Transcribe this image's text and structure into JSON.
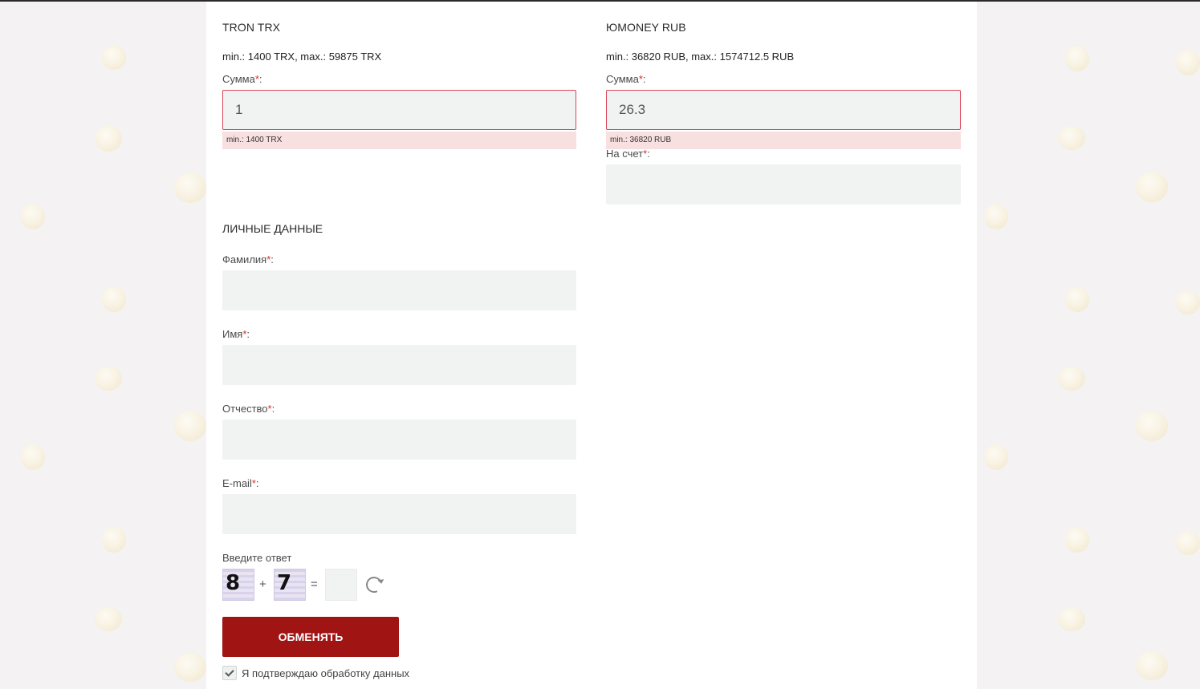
{
  "give": {
    "title": "TRON TRX",
    "limits": "min.: 1400 TRX, max.: 59875 TRX",
    "amount_label": "Сумма",
    "amount_value": "1",
    "error": "min.: 1400 TRX"
  },
  "receive": {
    "title": "ЮMONEY RUB",
    "limits": "min.: 36820 RUB, max.: 1574712.5 RUB",
    "amount_label": "Сумма",
    "amount_value": "26.3",
    "error": "min.: 36820 RUB",
    "account_label": "На счет",
    "account_value": ""
  },
  "personal": {
    "title": "ЛИЧНЫЕ ДАННЫЕ",
    "last_name_label": "Фамилия",
    "first_name_label": "Имя",
    "middle_name_label": "Отчество",
    "email_label": "E-mail"
  },
  "required_mark": "*",
  "label_suffix": ":",
  "captcha": {
    "label": "Введите ответ",
    "num1": "8",
    "op": "+",
    "num2": "7",
    "eq": "="
  },
  "submit_label": "ОБМЕНЯТЬ",
  "agree_label": "Я подтверждаю обработку данных",
  "colors": {
    "button": "#a11414",
    "required": "#d0312d",
    "error_border": "#d9465a",
    "error_bg": "#f8dfe0",
    "input_bg": "#f0f3f2"
  }
}
